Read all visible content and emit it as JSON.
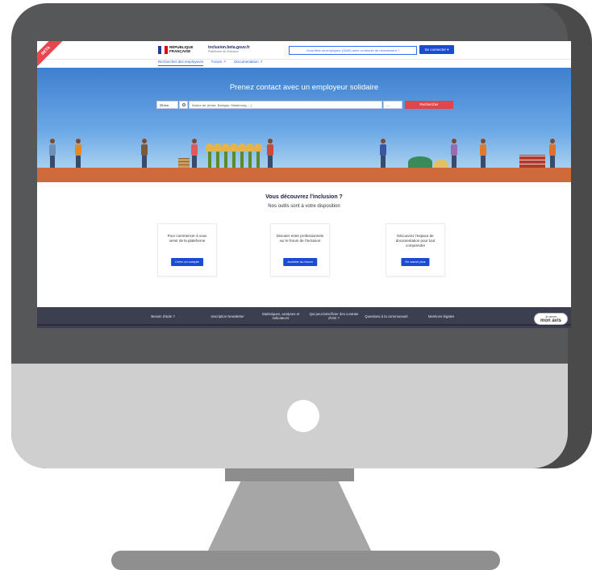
{
  "header": {
    "beta": "BETA",
    "republique": [
      "RÉPUBLIQUE",
      "FRANÇAISE"
    ],
    "site_name": "inclusion.beta.gouv.fr",
    "site_tagline": "Plateforme de l'inclusion",
    "message": "Vous êtes un employeur (SIAE) avec un besoin de recrutement ?",
    "connect_button": "Se connecter"
  },
  "subnav": {
    "items": [
      "Rechercher des employeurs",
      "Forum ↗",
      "Documentation ↗"
    ]
  },
  "hero": {
    "title": "Prenez contact avec un employeur solidaire",
    "radius": "25 km",
    "city_placeholder": "Autour de (Arras, Bobigny, Strasbourg, ...)",
    "kind": "---",
    "search_button": "Rechercher"
  },
  "discover": {
    "title": "Vous découvrez l'inclusion ?",
    "subtitle": "Nos outils sont à votre disposition"
  },
  "cards": [
    {
      "text": "Pour commencer à vous servir de la plateforme",
      "button": "Créer un compte"
    },
    {
      "text": "Discuter entre professionnels sur le forum de l'inclusion",
      "button": "Accéder au forum"
    },
    {
      "text": "Découvrez l'espace de documentation pour tout comprendre",
      "button": "En savoir plus"
    }
  ],
  "footer": {
    "links": [
      "Besoin d'aide ?",
      "Inscription Newsletter",
      "Statistiques, analyses et indicateurs",
      "Qui peut bénéficier des contrats d'IAE ?",
      "Questions à la communauté",
      "Mentions légales"
    ],
    "avis_top": "Je donne",
    "avis_bottom": "mon avis"
  },
  "colors": {
    "primary_blue": "#1a4bd1",
    "search_red": "#e2444c",
    "footer_bg": "#3b3f4f"
  }
}
